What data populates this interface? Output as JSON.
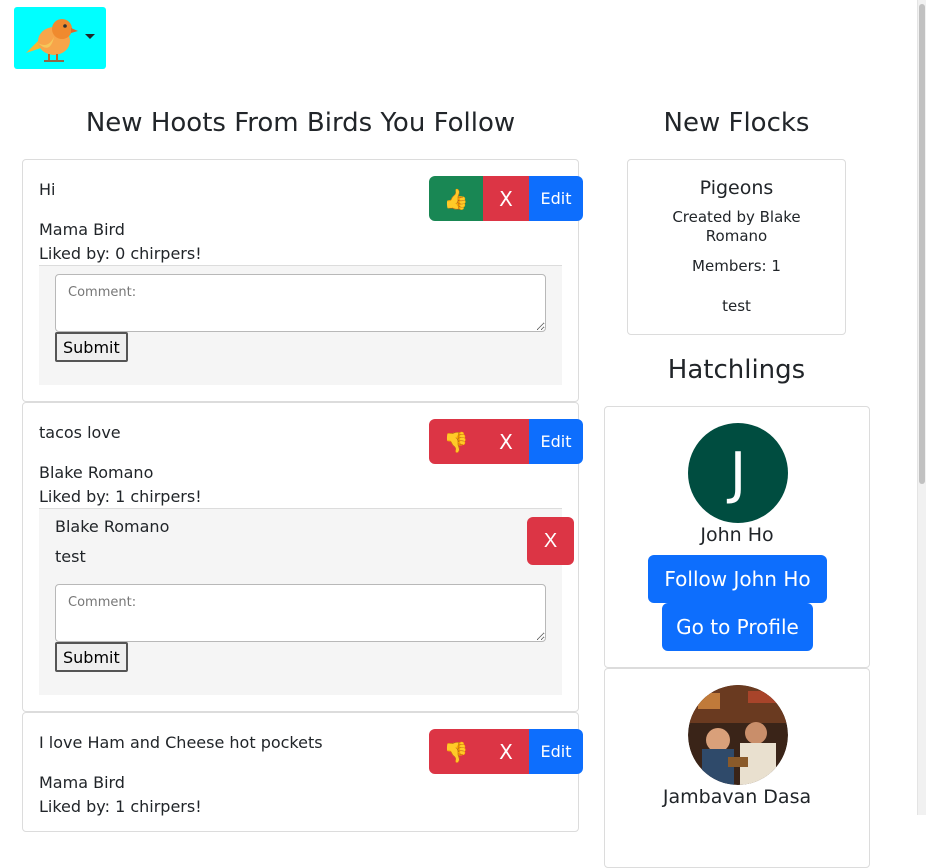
{
  "header": {
    "logo_icon": "bird-logo-icon",
    "menu_toggle": "caret-down-icon",
    "logo_bg": "#00ffff"
  },
  "feed": {
    "title": "New Hoots From Birds You Follow",
    "comment_placeholder": "Comment:",
    "submit_label": "Submit",
    "edit_label": "Edit",
    "delete_label": "X",
    "like_icon": "👍",
    "unlike_icon": "👎",
    "hoots": [
      {
        "text": "Hi",
        "author": "Mama Bird",
        "likes": "Liked by: 0 chirpers!",
        "liked": false,
        "comments": []
      },
      {
        "text": "tacos love",
        "author": "Blake Romano",
        "likes": "Liked by: 1 chirpers!",
        "liked": true,
        "comments": [
          {
            "author": "Blake Romano",
            "text": "test",
            "delete_label": "X"
          }
        ]
      },
      {
        "text": "I love Ham and Cheese hot pockets",
        "author": "Mama Bird",
        "likes": "Liked by: 1 chirpers!",
        "liked": true,
        "comments": []
      }
    ]
  },
  "flocks": {
    "title": "New Flocks",
    "items": [
      {
        "name": "Pigeons",
        "created_by": "Created by Blake Romano",
        "members": "Members: 1",
        "description": "test"
      }
    ]
  },
  "hatchlings": {
    "title": "Hatchlings",
    "users": [
      {
        "name": "John Ho",
        "initial": "J",
        "avatar_color": "#004d40",
        "follow_label": "Follow John Ho",
        "profile_label": "Go to Profile"
      },
      {
        "name": "Jambavan Dasa",
        "avatar": "photo"
      }
    ]
  },
  "colors": {
    "like": "#198754",
    "danger": "#dc3545",
    "primary": "#0d6efd"
  }
}
